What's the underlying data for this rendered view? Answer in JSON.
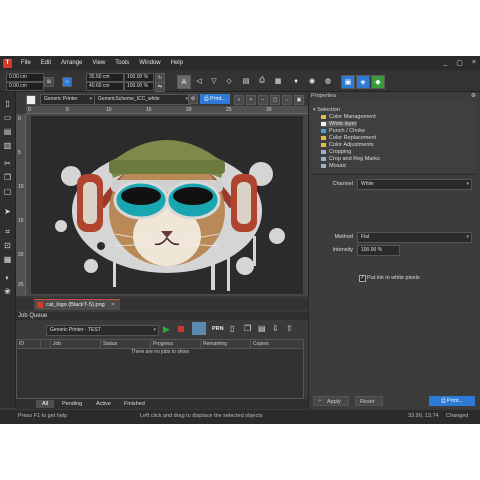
{
  "app": {
    "logo_letter": "T"
  },
  "menu": {
    "items": [
      "File",
      "Edit",
      "Arrange",
      "View",
      "Tools",
      "Window",
      "Help"
    ]
  },
  "window_controls": [
    "_",
    "▢",
    "×"
  ],
  "toolbar": {
    "x_value": "0.00 cm",
    "y_value": "0.00 cm",
    "width_value": "35.60 cm",
    "height_value": "40.60 cm",
    "scale_x": "100.00 %",
    "scale_y": "100.00 %",
    "icons": [
      "text-icon",
      "align-left-icon",
      "align-center-icon",
      "align-right-icon",
      "print-icon",
      "printer-settings-icon",
      "color-drop-icon",
      "color-profile-icon",
      "spot-icon",
      "app-blue-icon",
      "app-green-icon"
    ]
  },
  "options_bar": {
    "printer": "Generic Printer",
    "scheme": "GenericScheme_ICC_white",
    "print_label": "Print..."
  },
  "rulers": {
    "top": [
      "0",
      "5",
      "10",
      "15",
      "20",
      "25",
      "30"
    ],
    "left": [
      "0",
      "5",
      "10",
      "15",
      "20",
      "25"
    ]
  },
  "document": {
    "tab_label": "cat_logo (BlackT-S).png"
  },
  "job_queue": {
    "title": "Job Queue",
    "printer": "Generic Printer - TEST",
    "prn_label": "PRN",
    "columns": [
      "ID",
      "Job",
      "Status",
      "Progress",
      "Remaining",
      "Copies"
    ],
    "empty_message": "There are no jobs to show",
    "tabs": [
      "All",
      "Pending",
      "Active",
      "Finished"
    ],
    "active_tab": "All"
  },
  "right_panel": {
    "title": "Properties",
    "tree_root": "Selection",
    "tree_items": [
      "Color Management",
      "White layer",
      "Punch / Choke",
      "Color Replacement",
      "Color Adjustments",
      "Cropping",
      "Crop and Reg Marks",
      "Mosaic"
    ],
    "selected_item": "White layer",
    "channel_label": "Channel",
    "channel_value": "White",
    "method_label": "Method",
    "method_value": "Flat",
    "intensity_label": "Intensity",
    "intensity_value": "100.00 %",
    "checkbox_label": "Put ink in white pixels",
    "apply_label": "Apply",
    "reset_label": "Reset",
    "print_label": "Print..."
  },
  "status": {
    "left": "Press F1 to get help",
    "center": "Left click and drag to displace the selected objects",
    "coords": "33.90, 13.74",
    "state": "Changed"
  },
  "colors": {
    "accent_blue": "#2e7bd6",
    "logo_red": "#d23a2a",
    "play_green": "#2fae3a",
    "stop_red": "#c83a32"
  }
}
